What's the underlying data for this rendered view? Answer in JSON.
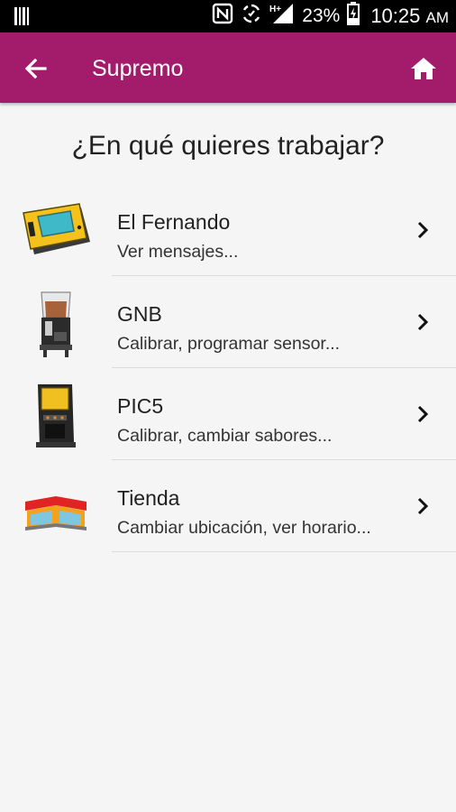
{
  "status_bar": {
    "battery_percent": "23%",
    "time": "10:25",
    "am_pm": "AM",
    "icons": [
      "barcode-icon",
      "nfc-icon",
      "sync-icon",
      "hplus-signal-icon",
      "battery-charging-icon"
    ]
  },
  "app_bar": {
    "title": "Supremo",
    "color": "#a31b6b",
    "back_icon": "arrow-back-icon",
    "home_icon": "home-icon"
  },
  "page": {
    "heading": "¿En qué quieres trabajar?"
  },
  "items": [
    {
      "name": "El Fernando",
      "description": "Ver mensajes...",
      "icon": "device-icon"
    },
    {
      "name": "GNB",
      "description": "Calibrar, programar sensor...",
      "icon": "dispenser-icon"
    },
    {
      "name": "PIC5",
      "description": "Calibrar, cambiar sabores...",
      "icon": "machine-icon"
    },
    {
      "name": "Tienda",
      "description": "Cambiar ubicación, ver horario...",
      "icon": "store-icon"
    }
  ]
}
